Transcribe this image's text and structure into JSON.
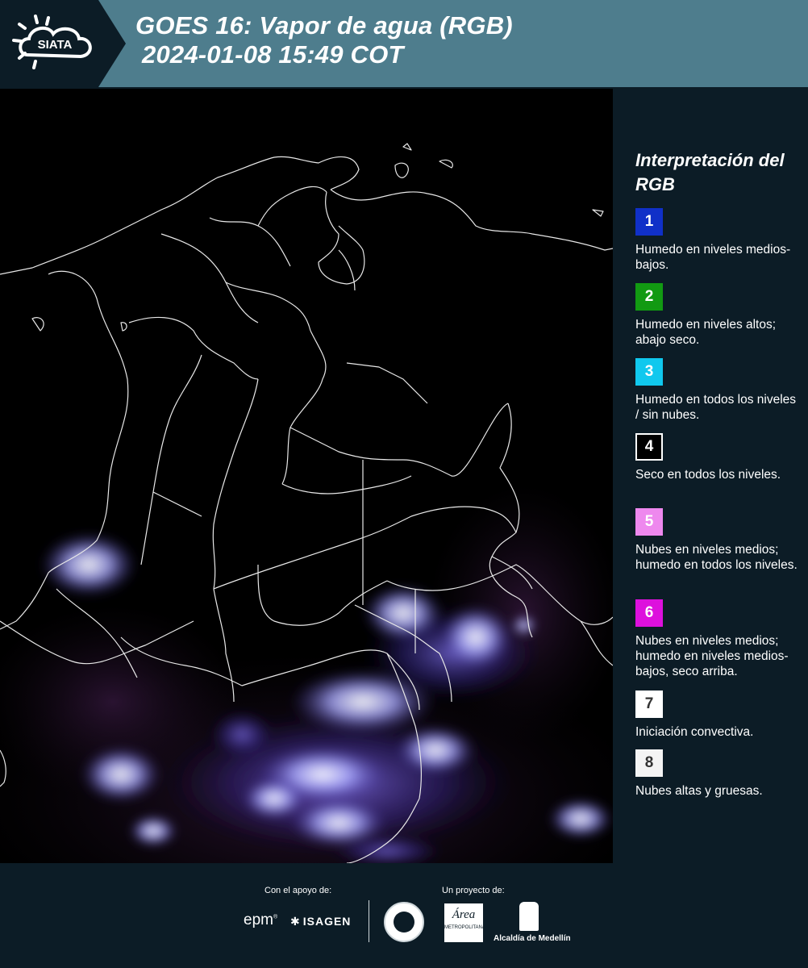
{
  "header": {
    "logo_text": "SIATA",
    "title_line1": "GOES 16: Vapor de agua (RGB)",
    "title_line2": "2024-01-08 15:49 COT"
  },
  "map": {
    "product": "GOES 16 water vapor RGB satellite image over Colombia with department boundaries"
  },
  "legend": {
    "title": "Interpretación del RGB",
    "items": [
      {
        "number": "1",
        "color": "#1030c8",
        "border": "#1030c8",
        "numcolor": "#ffffff",
        "text": "Humedo en niveles medios-bajos."
      },
      {
        "number": "2",
        "color": "#129a12",
        "border": "#129a12",
        "numcolor": "#ffffff",
        "text": "Humedo en niveles altos; abajo seco."
      },
      {
        "number": "3",
        "color": "#10c8ee",
        "border": "#10c8ee",
        "numcolor": "#ffffff",
        "text": "Humedo en todos los niveles / sin nubes."
      },
      {
        "number": "4",
        "color": "#000000",
        "border": "#ffffff",
        "numcolor": "#ffffff",
        "text": "Seco en todos los niveles."
      },
      {
        "number": "5",
        "color": "#ee88ee",
        "border": "#ee88ee",
        "numcolor": "#ffffff",
        "text": "Nubes en niveles medios; humedo en todos los niveles."
      },
      {
        "number": "6",
        "color": "#dd10dd",
        "border": "#dd10dd",
        "numcolor": "#ffffff",
        "text": "Nubes en niveles medios; humedo en niveles medios-bajos, seco arriba."
      },
      {
        "number": "7",
        "color": "#ffffff",
        "border": "#ffffff",
        "numcolor": "#333333",
        "text": "Iniciación convectiva."
      },
      {
        "number": "8",
        "color": "#f4f4f4",
        "border": "#f4f4f4",
        "numcolor": "#333333",
        "text": "Nubes altas y gruesas."
      }
    ]
  },
  "footer": {
    "support_label": "Con el apoyo de:",
    "project_label": "Un proyecto de:",
    "sponsor_epm": "epm",
    "sponsor_isagen": "ISAGEN",
    "area_metro": "Área",
    "area_metro_sub": "METROPOLITANA",
    "alcaldia": "Alcaldía de Medellín"
  }
}
